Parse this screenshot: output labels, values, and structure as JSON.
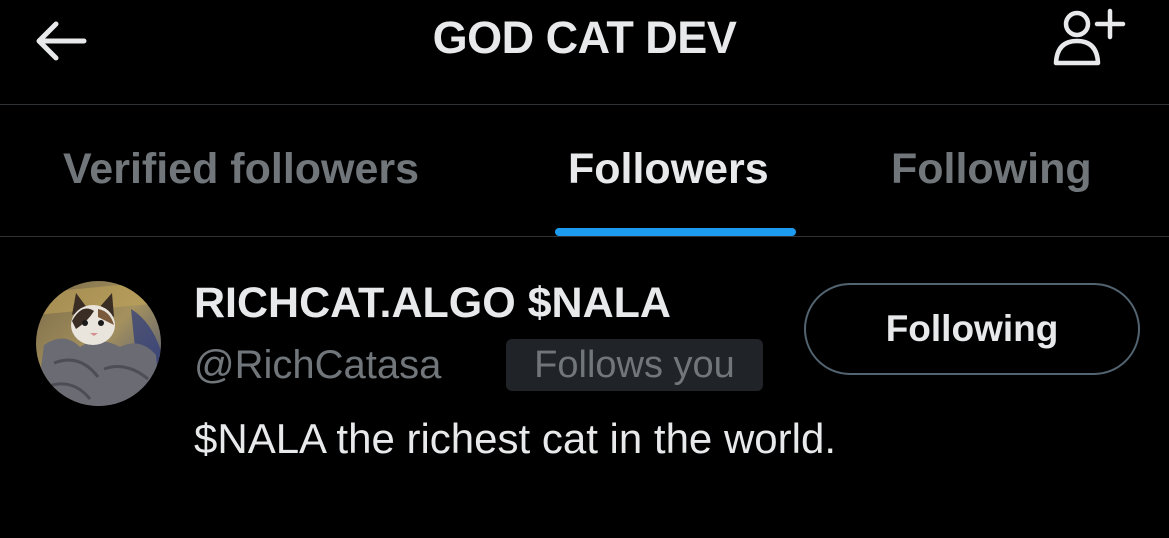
{
  "header": {
    "title": "GOD CAT DEV",
    "back_icon": "arrow-left-icon",
    "add_user_icon": "person-plus-icon"
  },
  "tabs": [
    {
      "label": "Verified followers",
      "active": false
    },
    {
      "label": "Followers",
      "active": true
    },
    {
      "label": "Following",
      "active": false
    }
  ],
  "accent_color": "#1d9bf0",
  "users": [
    {
      "name": "RICHCAT.ALGO $NALA",
      "handle": "@RichCatasa",
      "badge": "Follows you",
      "bio": "$NALA the richest cat in the world.",
      "button_label": "Following",
      "avatar_icon": "cat-avatar"
    }
  ]
}
